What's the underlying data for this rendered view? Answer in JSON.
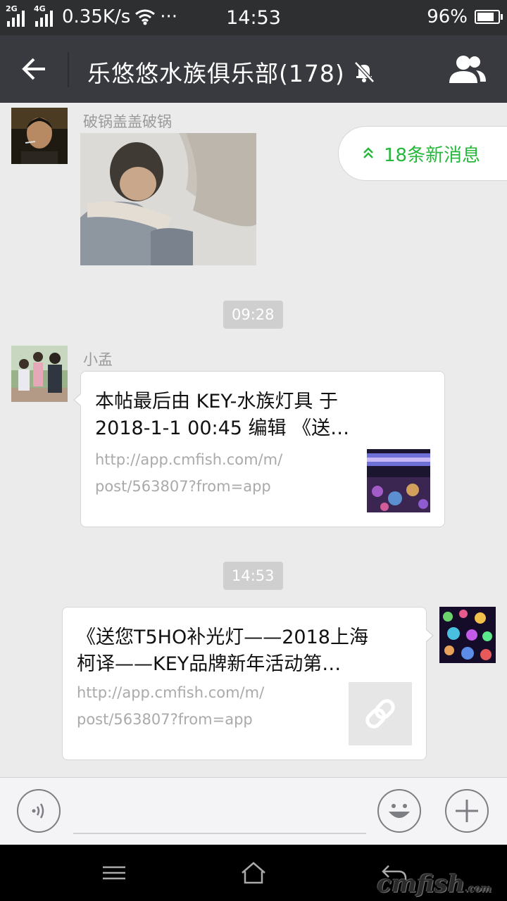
{
  "status_bar": {
    "net1": "2G",
    "net2": "4G",
    "speed": "0.35K/s",
    "more": "···",
    "time": "14:53",
    "battery": "96%",
    "battery_level": 0.96
  },
  "header": {
    "back_icon": "arrow-left-icon",
    "title": "乐悠悠水族俱乐部(178)",
    "mute_icon": "bell-off-icon",
    "members_icon": "group-icon"
  },
  "new_messages": {
    "label": "18条新消息",
    "icon": "double-chevron-up-icon",
    "color": "#26b73c"
  },
  "messages": [
    {
      "sender": "破锅盖盖破锅",
      "type": "image"
    },
    {
      "time": "09:28"
    },
    {
      "sender": "小孟",
      "type": "link",
      "title_line1": "本帖最后由 KEY-水族灯具 于",
      "title_line2": "2018-1-1 00:45 编辑 《送…",
      "url_line1": "http://app.cmfish.com/m/",
      "url_line2": "post/563807?from=app"
    },
    {
      "time": "14:53"
    },
    {
      "sender": "self",
      "type": "link",
      "title_line1": "《送您T5HO补光灯——2018上海",
      "title_line2": "柯译——KEY品牌新年活动第…",
      "url_line1": "http://app.cmfish.com/m/",
      "url_line2": "post/563807?from=app",
      "thumb_icon": "link-icon"
    }
  ],
  "input_bar": {
    "voice_icon": "voice-icon",
    "emoji_icon": "emoji-icon",
    "plus_icon": "plus-icon"
  },
  "nav_bar": {
    "menu_icon": "menu-icon",
    "home_icon": "home-icon",
    "back_icon": "back-icon",
    "watermark": "cmfish",
    "watermark_suffix": ".com"
  },
  "colors": {
    "title_bar": "#393a3f",
    "status_bar": "#2d2f31",
    "chat_bg": "#ebebeb"
  }
}
